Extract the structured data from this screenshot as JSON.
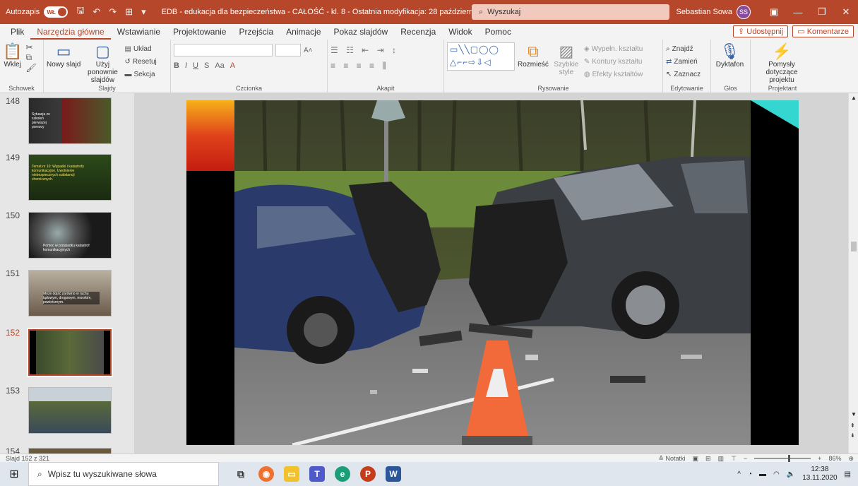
{
  "titlebar": {
    "autosave_label": "Autozapis",
    "toggle": "WŁ",
    "doc_title": "EDB - edukacja dla bezpieczeństwa - CAŁOŚĆ - kl. 8  -  Ostatnia modyfikacja: 28 października",
    "search_placeholder": "Wyszukaj",
    "user_name": "Sebastian Sowa",
    "user_initials": "SS"
  },
  "tabs": [
    "Plik",
    "Narzędzia główne",
    "Wstawianie",
    "Projektowanie",
    "Przejścia",
    "Animacje",
    "Pokaz slajdów",
    "Recenzja",
    "Widok",
    "Pomoc"
  ],
  "share": {
    "share_label": "Udostępnij",
    "comments_label": "Komentarze"
  },
  "ribbon": {
    "schowek": {
      "paste": "Wklej",
      "label": "Schowek"
    },
    "slajdy": {
      "new_slide": "Nowy slajd",
      "reuse": "Użyj ponownie slajdów",
      "layout": "Układ",
      "reset": "Resetuj",
      "section": "Sekcja",
      "label": "Slajdy"
    },
    "czcionka": {
      "label": "Czcionka",
      "bold": "B",
      "italic": "I",
      "underline": "U",
      "strike": "S",
      "grow": "A˄",
      "shrink": "A˅",
      "case": "Aa"
    },
    "akapit": {
      "label": "Akapit"
    },
    "rysowanie": {
      "label": "Rysowanie",
      "arrange": "Rozmieść",
      "quick_styles": "Szybkie style",
      "fill": "Wypełn. kształtu",
      "outline": "Kontury kształtu",
      "effects": "Efekty kształtów"
    },
    "edytowanie": {
      "label": "Edytowanie",
      "find": "Znajdź",
      "replace": "Zamień",
      "select": "Zaznacz"
    },
    "glos": {
      "label": "Głos",
      "dictate": "Dyktafon"
    },
    "projektant": {
      "label": "Projektant",
      "ideas": "Pomysły dotyczące projektu"
    }
  },
  "thumbnails": [
    {
      "num": "148",
      "caption": "Sytuacja ze szkoleń pierwszej pomocy"
    },
    {
      "num": "149",
      "caption": "Temat nr 10: Wypadki i katastrofy komunikacyjne. Uwolnienie niebezpiecznych substancji chemicznych."
    },
    {
      "num": "150",
      "caption": "Pomoc w przypadku katastrof komunikacyjnych"
    },
    {
      "num": "151",
      "caption": "Może dojść zarówno w ruchu lądowym, drogowym, morskim, powietrznym."
    },
    {
      "num": "152",
      "caption": ""
    },
    {
      "num": "153",
      "caption": ""
    },
    {
      "num": "154",
      "caption": ""
    }
  ],
  "status": {
    "slide_info": "Slajd 152 z 321",
    "notes": "Notatki",
    "zoom": "86%"
  },
  "taskbar": {
    "search_placeholder": "Wpisz tu wyszukiwane słowa",
    "time": "12:38",
    "date": "13.11.2020"
  },
  "colors": {
    "accent": "#b7472a",
    "ribbon_bg": "#f3f3f3"
  }
}
